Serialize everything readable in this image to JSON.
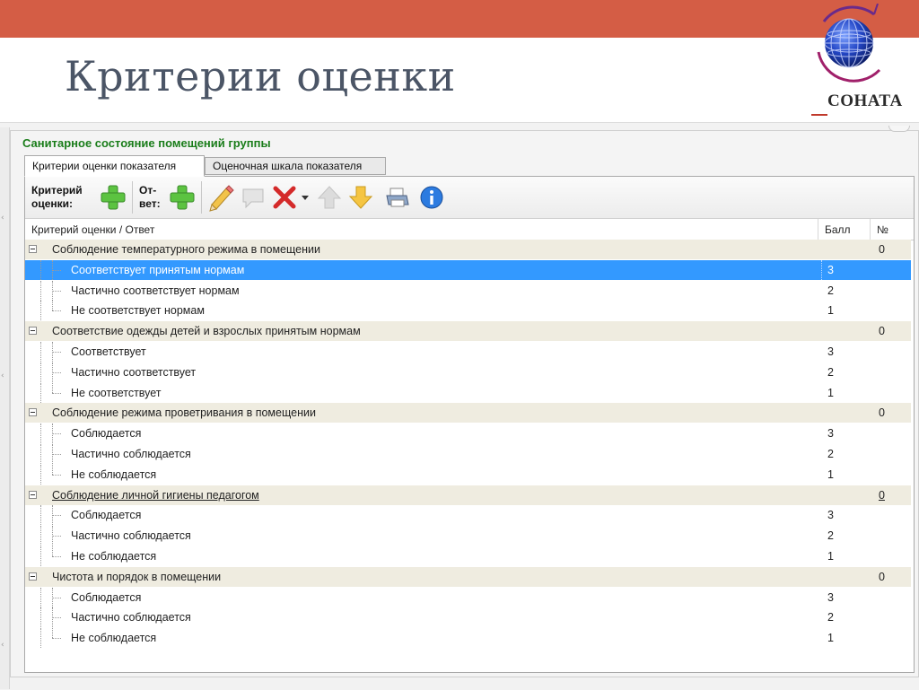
{
  "slide": {
    "title": "Критерии оценки",
    "logo_text": "СОНАТА"
  },
  "window": {
    "title": "Санитарное состояние помещений группы"
  },
  "tabs": [
    {
      "label": "Критерии оценки показателя",
      "active": true
    },
    {
      "label": "Оценочная шкала показателя",
      "active": false
    }
  ],
  "toolbar": {
    "criterion_label_1": "Критерий",
    "criterion_label_2": "оценки:",
    "answer_label_1": "От-",
    "answer_label_2": "вет:",
    "icons": [
      "add-criterion-icon",
      "add-answer-icon",
      "edit-icon",
      "comment-icon",
      "delete-icon",
      "dropdown-arrow-icon",
      "move-up-icon",
      "move-down-icon",
      "print-icon",
      "info-icon"
    ]
  },
  "columns": {
    "name": "Критерий оценки / Ответ",
    "score": "Балл",
    "number": "№"
  },
  "groups": [
    {
      "title": "Соблюдение температурного режима в помещении",
      "number": "0",
      "answers": [
        {
          "label": "Соответствует принятым нормам",
          "score": "3",
          "selected": true
        },
        {
          "label": "Частично соответствует нормам",
          "score": "2"
        },
        {
          "label": "Не соответствует нормам",
          "score": "1"
        }
      ]
    },
    {
      "title": "Соответствие одежды детей и взрослых принятым нормам",
      "number": "0",
      "answers": [
        {
          "label": "Соответствует",
          "score": "3"
        },
        {
          "label": "Частично соответствует",
          "score": "2"
        },
        {
          "label": "Не соответствует",
          "score": "1"
        }
      ]
    },
    {
      "title": "Соблюдение режима проветривания в помещении",
      "number": "0",
      "answers": [
        {
          "label": "Соблюдается",
          "score": "3"
        },
        {
          "label": "Частично соблюдается",
          "score": "2"
        },
        {
          "label": "Не соблюдается",
          "score": "1"
        }
      ]
    },
    {
      "title": "Соблюдение  личной гигиены педагогом",
      "number": "0",
      "underlined": true,
      "answers": [
        {
          "label": "Соблюдается",
          "score": "3"
        },
        {
          "label": "Частично соблюдается",
          "score": "2"
        },
        {
          "label": "Не соблюдается",
          "score": "1"
        }
      ]
    },
    {
      "title": "Чистота и порядок в помещении",
      "number": "0",
      "answers": [
        {
          "label": "Соблюдается",
          "score": "3"
        },
        {
          "label": "Частично соблюдается",
          "score": "2"
        },
        {
          "label": "Не соблюдается",
          "score": "1"
        }
      ]
    }
  ],
  "colors": {
    "topbar": "#d45d45",
    "title_text": "#4b5566",
    "window_title": "#1a7d1a",
    "group_row": "#efece0",
    "selection": "#3399ff"
  }
}
